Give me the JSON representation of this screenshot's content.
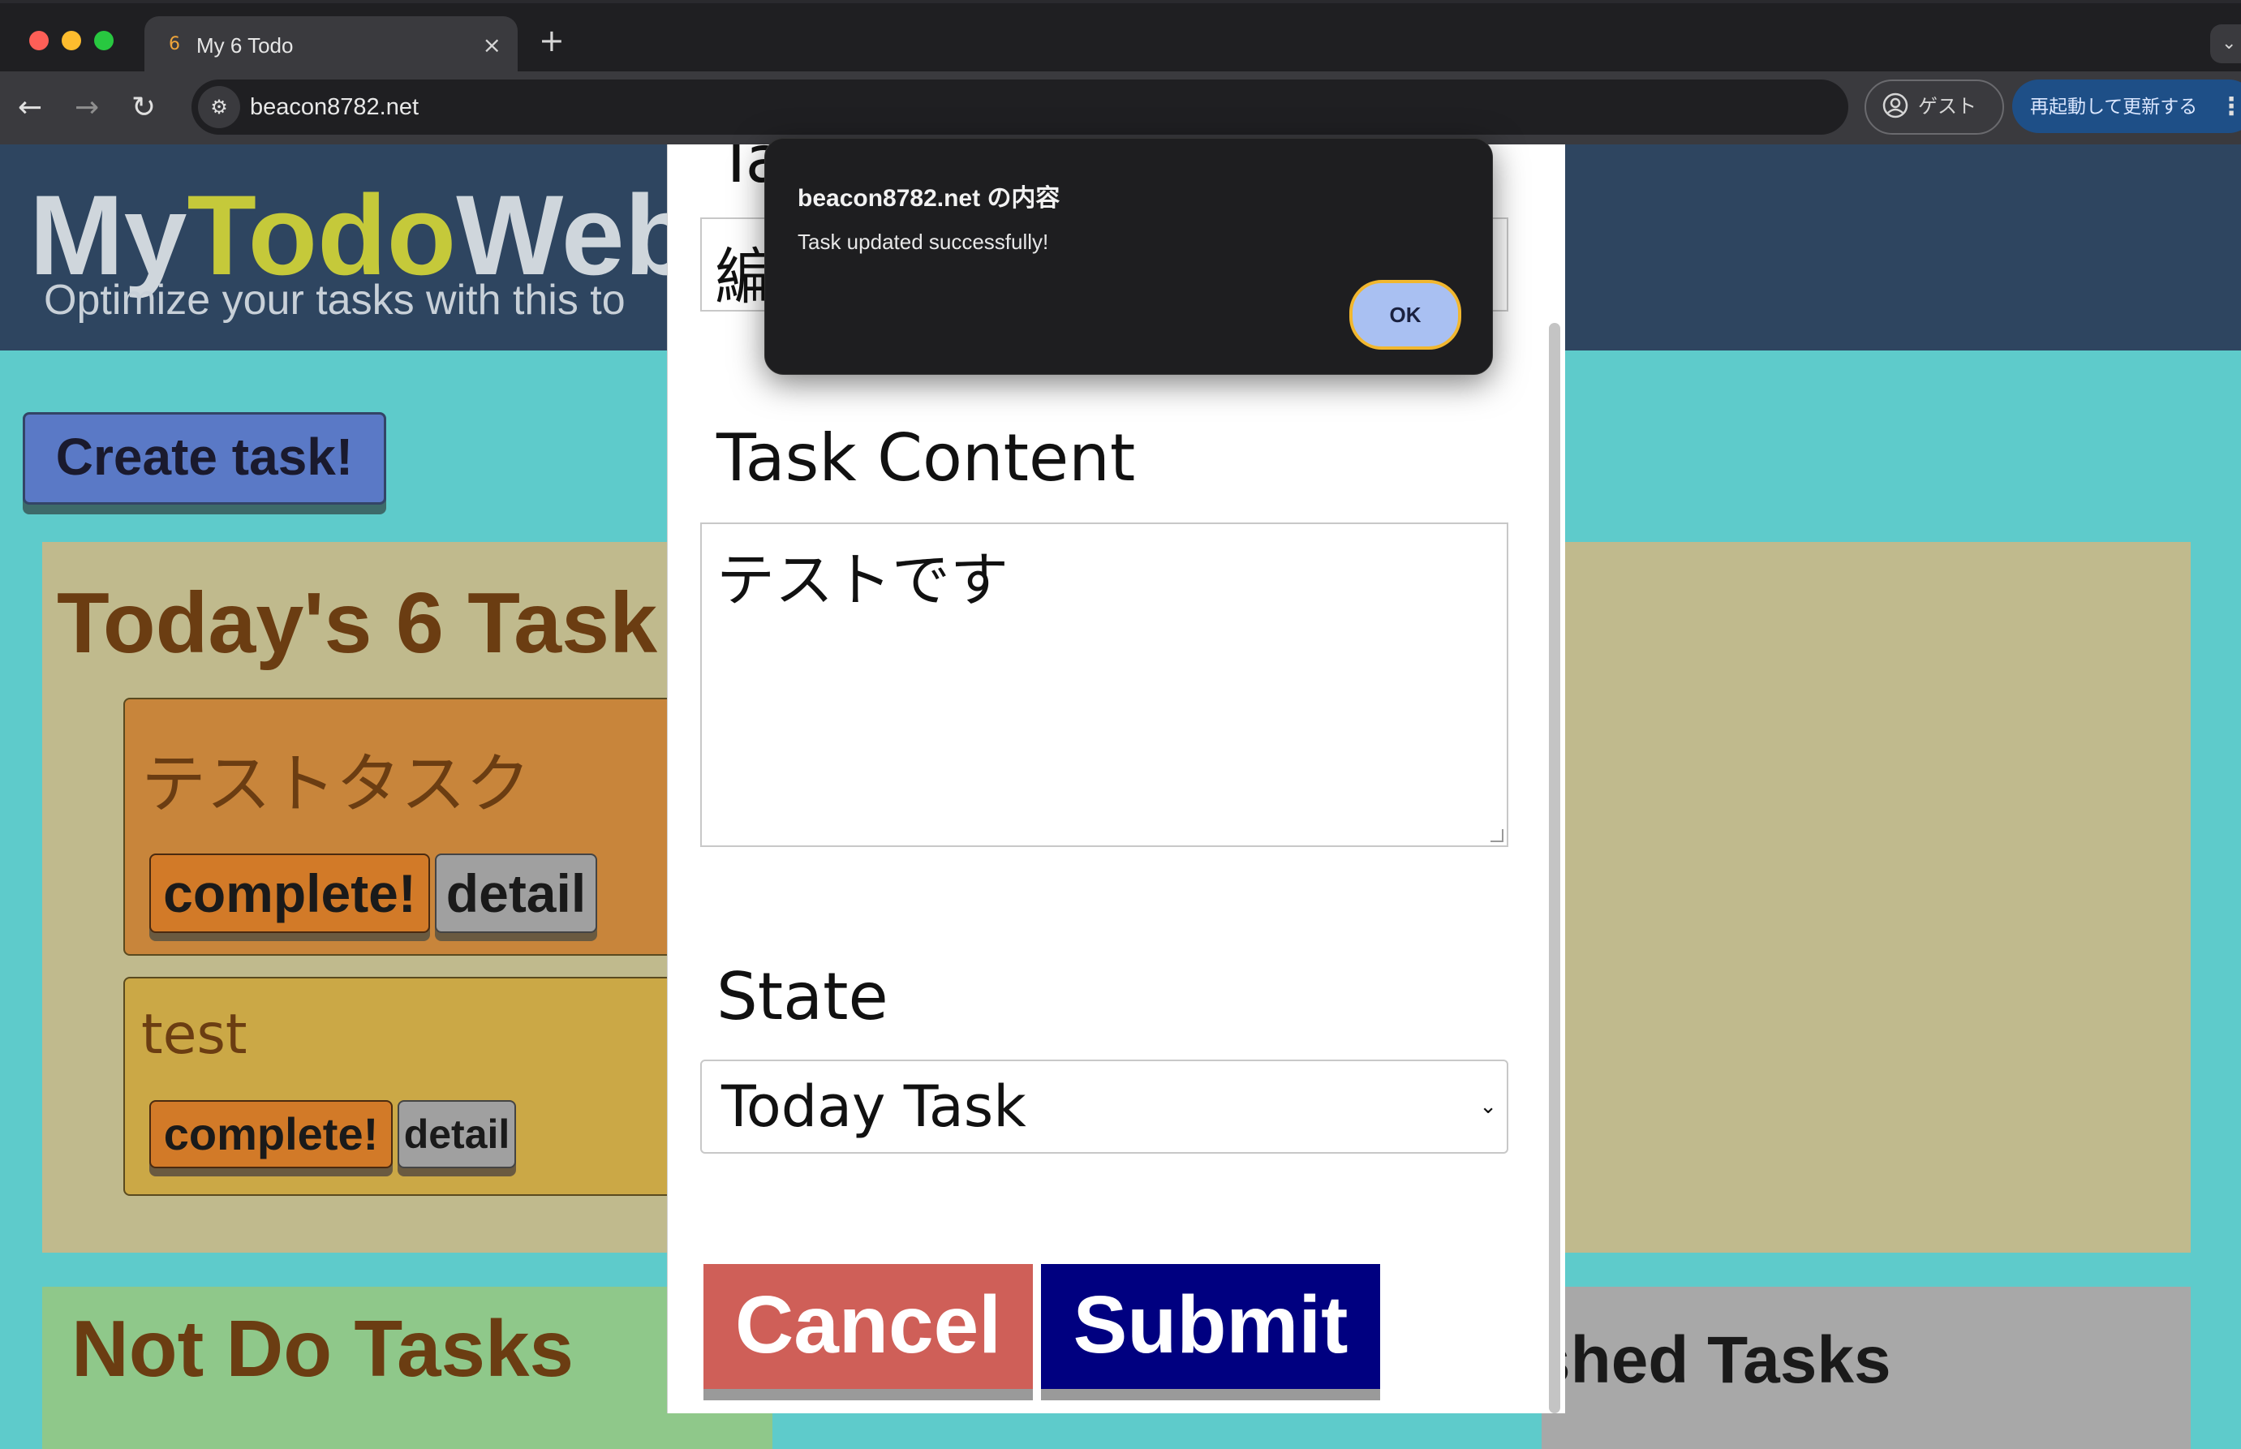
{
  "browser": {
    "tab_favicon": "6",
    "tab_title": "My 6 Todo",
    "tab_close": "×",
    "new_tab": "+",
    "url": "beacon8782.net",
    "guest_label": "ゲスト",
    "update_label": "再起動して更新する",
    "icons": [
      "back-icon",
      "forward-icon",
      "reload-icon",
      "site-settings-icon",
      "profile-icon",
      "menu-icon"
    ]
  },
  "site": {
    "title_part1": "My",
    "title_part2": "Todo",
    "title_part3": "Web",
    "tagline": "Optimize your tasks with this to",
    "create_button": "Create task!"
  },
  "today": {
    "title": "Today's 6 Task",
    "tasks": [
      {
        "title": "テストタスク",
        "complete_label": "complete!",
        "detail_label": "detail"
      },
      {
        "title": "test",
        "complete_label": "complete!",
        "detail_label": "detail"
      }
    ]
  },
  "not_do": {
    "title": "Not Do Tasks"
  },
  "finished": {
    "title": "shed Tasks"
  },
  "modal": {
    "title_label_partial": "Ta",
    "title_value_partial": "編",
    "content_label": "Task Content",
    "content_value": "テストです",
    "state_label": "State",
    "state_value": "Today Task",
    "cancel_label": "Cancel",
    "submit_label": "Submit"
  },
  "alert": {
    "title": "beacon8782.net の内容",
    "message": "Task updated successfully!",
    "ok_label": "OK"
  },
  "colors": {
    "header_bg": "#2e4560",
    "page_bg": "#5ecbcb",
    "accent_todo": "#c5c93a",
    "today_panel": "#c0ba8d",
    "submit": "#000080",
    "cancel": "#cf5f58",
    "ok_focus": "#f1b72f"
  }
}
